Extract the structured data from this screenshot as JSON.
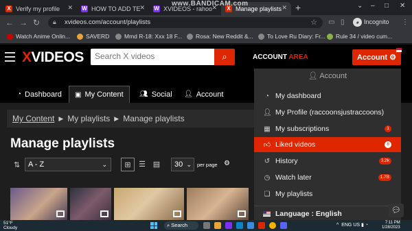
{
  "browser": {
    "tabs": [
      {
        "title": "Verify my profile",
        "favicon": "X"
      },
      {
        "title": "HOW TO ADD TE",
        "favicon": "W"
      },
      {
        "title": "XVIDEOS - rahoo",
        "favicon": "W"
      },
      {
        "title": "Manage playlists",
        "favicon": "X",
        "active": true
      }
    ],
    "watermark": "www.BANDICAM.com",
    "url": "xvideos.com/account/playlists",
    "profile_label": "Incognito",
    "bookmarks": [
      "Watch Anime Onlin...",
      "SAVERD",
      "Mmd R-18: Xxx 18 F...",
      "Rosa: New Reddit &...",
      "To Love Ru Diary: Fr...",
      "Rule 34 / video cum..."
    ]
  },
  "site": {
    "logo_x": "X",
    "logo_rest": "VIDEOS",
    "search_placeholder": "Search X videos",
    "account_area_1": "ACCOUNT",
    "account_area_2": "AREA",
    "account_button": "Account",
    "tabs": [
      "Dashboard",
      "My Content",
      "Social",
      "Account"
    ],
    "active_tab": "My Content"
  },
  "main": {
    "breadcrumb": [
      "My Content",
      "My playlists",
      "Manage playlists"
    ],
    "title": "Manage playlists",
    "sort_value": "A - Z",
    "per_page_value": "30",
    "per_page_label": "per page"
  },
  "menu": {
    "header": "Account",
    "items": [
      {
        "label": "My dashboard",
        "icon": "dashboard-icon"
      },
      {
        "label": "My Profile (raccoonsjustraccoons)",
        "icon": "user-icon"
      },
      {
        "label": "My subscriptions",
        "icon": "subscriptions-icon",
        "badge": "1"
      },
      {
        "label": "Liked videos",
        "icon": "thumbs-up-icon",
        "badge": "8",
        "active": true
      },
      {
        "label": "History",
        "icon": "history-icon",
        "badge": "3.2k"
      },
      {
        "label": "Watch later",
        "icon": "clock-icon",
        "badge": "1.7B"
      },
      {
        "label": "My playlists",
        "icon": "playlist-icon"
      }
    ],
    "language": "Language : English"
  },
  "taskbar": {
    "temperature": "51°F",
    "weather": "Cloudy",
    "search_label": "Search",
    "lang_1": "ENG",
    "lang_2": "US",
    "time": "7:11 PM",
    "date": "1/28/2023"
  },
  "colors": {
    "accent": "#de2600",
    "background": "#1e1e1e",
    "header": "#000000",
    "menu": "#2f2f2f"
  }
}
